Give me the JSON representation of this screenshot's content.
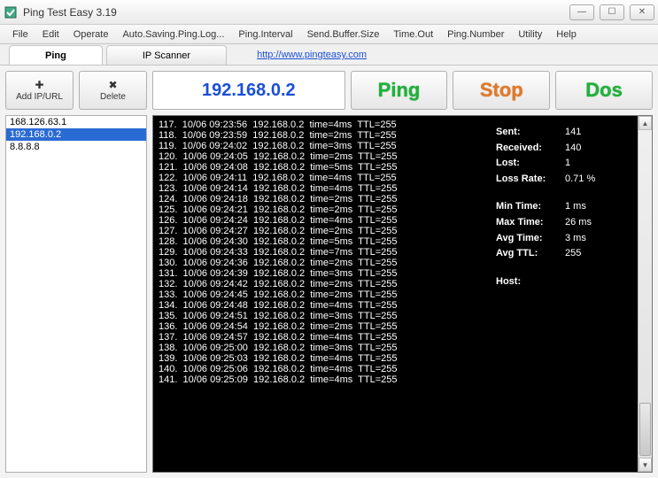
{
  "window": {
    "title": "Ping Test Easy 3.19"
  },
  "window_controls": {
    "min": "—",
    "max": "☐",
    "close": "✕"
  },
  "menubar": [
    "File",
    "Edit",
    "Operate",
    "Auto.Saving.Ping.Log...",
    "Ping.Interval",
    "Send.Buffer.Size",
    "Time.Out",
    "Ping.Number",
    "Utility",
    "Help"
  ],
  "tabs": {
    "ping": "Ping",
    "ipscanner": "IP Scanner",
    "link": "http://www.pingteasy.com"
  },
  "sidebar_buttons": {
    "add": "Add IP/URL",
    "delete": "Delete"
  },
  "iplist": [
    "168.126.63.1",
    "192.168.0.2",
    "8.8.8.8"
  ],
  "iplist_selected": 1,
  "ip_input": "192.168.0.2",
  "action_buttons": {
    "ping": "Ping",
    "stop": "Stop",
    "dos": "Dos"
  },
  "log_lines": [
    "117.  10/06 09:23:56  192.168.0.2  time=4ms  TTL=255",
    "118.  10/06 09:23:59  192.168.0.2  time=2ms  TTL=255",
    "119.  10/06 09:24:02  192.168.0.2  time=3ms  TTL=255",
    "120.  10/06 09:24:05  192.168.0.2  time=2ms  TTL=255",
    "121.  10/06 09:24:08  192.168.0.2  time=5ms  TTL=255",
    "122.  10/06 09:24:11  192.168.0.2  time=4ms  TTL=255",
    "123.  10/06 09:24:14  192.168.0.2  time=4ms  TTL=255",
    "124.  10/06 09:24:18  192.168.0.2  time=2ms  TTL=255",
    "125.  10/06 09:24:21  192.168.0.2  time=2ms  TTL=255",
    "126.  10/06 09:24:24  192.168.0.2  time=4ms  TTL=255",
    "127.  10/06 09:24:27  192.168.0.2  time=2ms  TTL=255",
    "128.  10/06 09:24:30  192.168.0.2  time=5ms  TTL=255",
    "129.  10/06 09:24:33  192.168.0.2  time=7ms  TTL=255",
    "130.  10/06 09:24:36  192.168.0.2  time=2ms  TTL=255",
    "131.  10/06 09:24:39  192.168.0.2  time=3ms  TTL=255",
    "132.  10/06 09:24:42  192.168.0.2  time=2ms  TTL=255",
    "133.  10/06 09:24:45  192.168.0.2  time=2ms  TTL=255",
    "134.  10/06 09:24:48  192.168.0.2  time=4ms  TTL=255",
    "135.  10/06 09:24:51  192.168.0.2  time=3ms  TTL=255",
    "136.  10/06 09:24:54  192.168.0.2  time=2ms  TTL=255",
    "137.  10/06 09:24:57  192.168.0.2  time=4ms  TTL=255",
    "138.  10/06 09:25:00  192.168.0.2  time=3ms  TTL=255",
    "139.  10/06 09:25:03  192.168.0.2  time=4ms  TTL=255",
    "140.  10/06 09:25:06  192.168.0.2  time=4ms  TTL=255",
    "141.  10/06 09:25:09  192.168.0.2  time=4ms  TTL=255"
  ],
  "stats": {
    "sent_label": "Sent:",
    "sent": "141",
    "recv_label": "Received:",
    "recv": "140",
    "lost_label": "Lost:",
    "lost": "1",
    "loss_label": "Loss Rate:",
    "loss": "0.71 %",
    "min_label": "Min Time:",
    "min": "1 ms",
    "max_label": "Max Time:",
    "max": "26 ms",
    "avg_label": "Avg Time:",
    "avg": "3 ms",
    "ttl_label": "Avg TTL:",
    "ttl": "255",
    "host_label": "Host:",
    "host": ""
  }
}
